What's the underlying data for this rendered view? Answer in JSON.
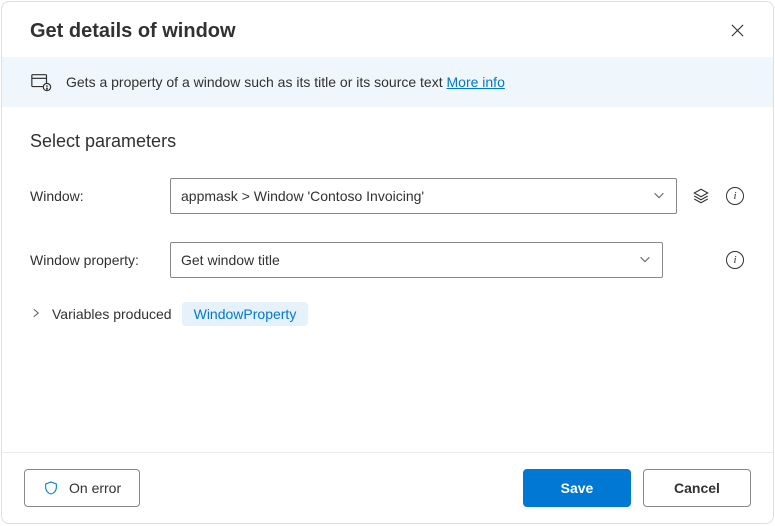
{
  "header": {
    "title": "Get details of window"
  },
  "banner": {
    "text": "Gets a property of a window such as its title or its source text ",
    "link": "More info"
  },
  "section": {
    "title": "Select parameters"
  },
  "fields": {
    "window": {
      "label": "Window:",
      "value": "appmask > Window 'Contoso Invoicing'"
    },
    "property": {
      "label": "Window property:",
      "value": "Get window title"
    }
  },
  "variables": {
    "label": "Variables produced",
    "chip": "WindowProperty"
  },
  "footer": {
    "on_error": "On error",
    "save": "Save",
    "cancel": "Cancel"
  }
}
